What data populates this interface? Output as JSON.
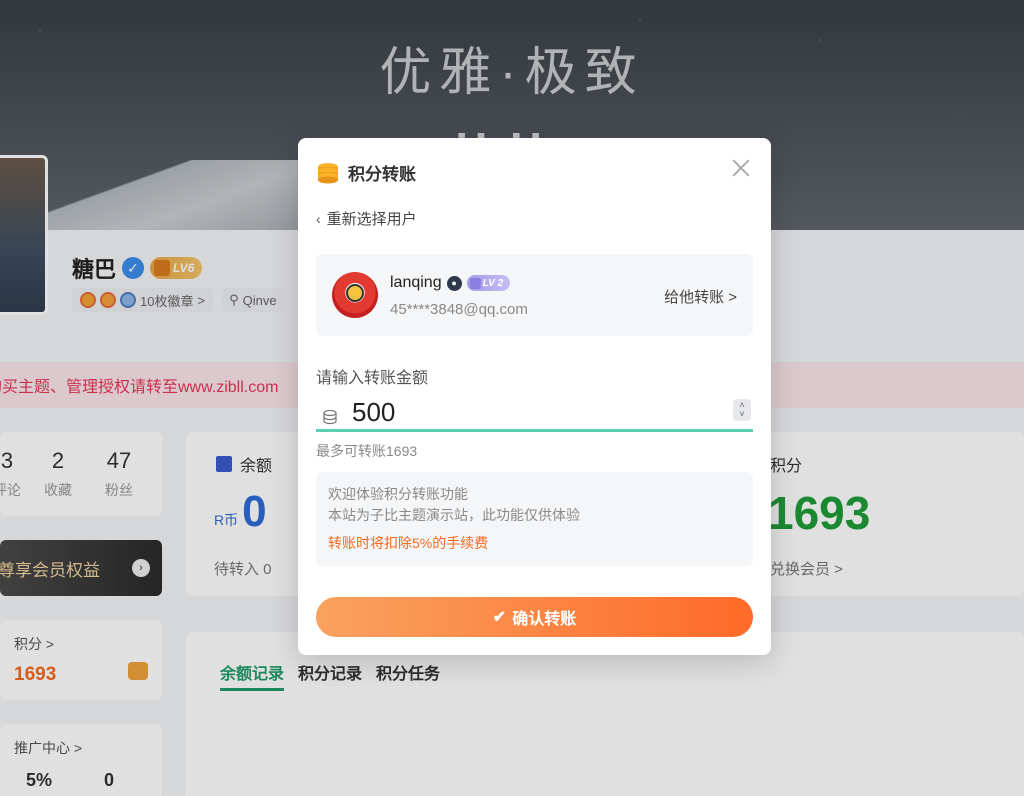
{
  "hero": {
    "slogan": "优雅·极致",
    "logo_text": "zibll"
  },
  "profile": {
    "name": "糖巴",
    "level": "LV6",
    "badges_label": "10枚徽章",
    "badges_chevron": ">",
    "author_label": "Qinve"
  },
  "notice": {
    "text": "购买主题、管理授权请转至www.zibll.com"
  },
  "stats": [
    {
      "value": "3",
      "label": "评论"
    },
    {
      "value": "2",
      "label": "收藏"
    },
    {
      "value": "47",
      "label": "粉丝"
    }
  ],
  "vip": {
    "label": "尊享会员权益"
  },
  "points_card": {
    "label": "积分 >",
    "value": "1693"
  },
  "promo_card": {
    "label": "推广中心 >",
    "rate": "5%",
    "count": "0"
  },
  "balance": {
    "title": "余额",
    "currency": "R币",
    "value": "0",
    "pending": "待转入 0",
    "points_title": "积分",
    "points_value": "1693",
    "exchange": "兑换会员 >"
  },
  "records": {
    "tabs": [
      "余额记录",
      "积分记录",
      "积分任务"
    ]
  },
  "modal": {
    "title": "积分转账",
    "reselect": "重新选择用户",
    "user": {
      "name": "lanqing",
      "level": "LV 2",
      "email": "45****3848@qq.com",
      "transfer_link": "给他转账 >"
    },
    "amount_label": "请输入转账金额",
    "amount_value": "500",
    "max_hint": "最多可转账1693",
    "info_lines": [
      "欢迎体验积分转账功能",
      "本站为子比主题演示站，此功能仅供体验"
    ],
    "info_warning": "转账时将扣除5%的手续费",
    "confirm": "确认转账"
  },
  "colors": {
    "accent_orange": "#ff6a28",
    "input_underline": "#5ccfb7",
    "green_points": "#1f9d3a",
    "blue_balance": "#2f6bd8",
    "notice_red": "#e5365a"
  }
}
